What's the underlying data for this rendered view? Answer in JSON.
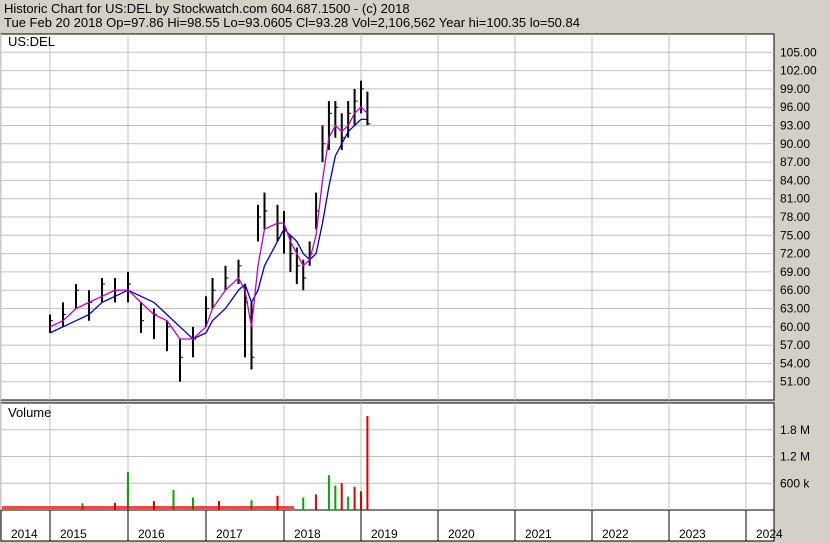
{
  "header": {
    "line1": "Historic Chart for US:DEL by Stockwatch.com 604.687.1500 - (c) 2018",
    "line2": "Tue Feb 20 2018   Op=97.86   Hi=98.55   Lo=93.0605   Cl=93.28   Vol=2,106,562   Year hi=100.35   lo=50.84"
  },
  "colors": {
    "background": "#d4d0c8",
    "plot": "#ffffff",
    "grid": "#c0c0c0",
    "price": "#000000",
    "ma_short": "#c000c0",
    "ma_long": "#0000c0",
    "vol_up": "#00aa00",
    "vol_down": "#dd0000"
  },
  "chart_data": [
    {
      "type": "candlestick",
      "title": "US:DEL",
      "ylim": [
        48,
        108
      ],
      "yticks": [
        "105.00",
        "102.00",
        "99.00",
        "96.00",
        "93.00",
        "90.00",
        "87.00",
        "84.00",
        "81.00",
        "78.00",
        "75.00",
        "72.00",
        "69.00",
        "66.00",
        "63.00",
        "60.00",
        "57.00",
        "54.00",
        "51.00"
      ],
      "x": [
        "2014-01",
        "2014-03",
        "2014-05",
        "2014-07",
        "2014-09",
        "2014-11",
        "2015-01",
        "2015-03",
        "2015-05",
        "2015-07",
        "2015-09",
        "2015-11",
        "2016-01",
        "2016-02",
        "2016-04",
        "2016-06",
        "2016-07",
        "2016-08",
        "2016-09",
        "2016-10",
        "2016-12",
        "2017-01",
        "2017-02",
        "2017-03",
        "2017-04",
        "2017-05",
        "2017-06",
        "2017-07",
        "2017-08",
        "2017-09",
        "2017-10",
        "2017-11",
        "2017-12",
        "2018-01",
        "2018-02"
      ],
      "close": [
        61,
        62,
        66,
        64,
        67,
        66,
        67,
        61,
        62,
        60,
        55,
        58,
        63,
        66,
        68,
        70,
        64,
        55,
        78,
        79,
        77,
        76,
        72,
        70,
        68,
        72,
        79,
        90,
        95,
        96,
        91,
        95,
        97,
        99,
        93.28
      ],
      "high": [
        62,
        64,
        67,
        66,
        68,
        68,
        69,
        64,
        63,
        61,
        58,
        60,
        65,
        68,
        70,
        71,
        67,
        64,
        80,
        82,
        80,
        79,
        75,
        73,
        71,
        74,
        82,
        93,
        97,
        97,
        95,
        97,
        99,
        100.35,
        98.55
      ],
      "low": [
        59,
        60,
        63,
        61,
        64,
        64,
        64,
        59,
        58,
        56,
        51,
        55,
        60,
        63,
        66,
        67,
        55,
        53,
        74,
        76,
        74,
        72,
        69,
        67,
        66,
        70,
        76,
        87,
        89,
        91,
        89,
        91,
        93,
        95,
        93.06
      ],
      "ma_short": [
        60,
        61,
        63,
        64,
        65,
        66,
        66,
        64,
        62,
        61,
        58,
        58,
        60,
        63,
        66,
        68,
        66,
        60,
        70,
        76,
        77,
        77,
        74,
        72,
        70,
        71,
        75,
        84,
        91,
        93,
        92,
        93,
        95,
        96,
        95
      ],
      "ma_long": [
        59,
        60,
        61,
        62,
        64,
        65,
        66,
        65,
        64,
        62,
        60,
        58,
        59,
        61,
        63,
        66,
        67,
        64,
        66,
        70,
        74,
        76,
        75,
        74,
        72,
        71,
        72,
        77,
        83,
        88,
        90,
        92,
        93,
        94,
        94
      ]
    },
    {
      "type": "bar",
      "title": "Volume",
      "ylim": [
        0,
        2400000
      ],
      "yticks": [
        "1.8 M",
        "1.2 M",
        "600 k"
      ],
      "x": [
        "2014-06",
        "2014-11",
        "2015-01",
        "2015-05",
        "2015-08",
        "2015-11",
        "2016-03",
        "2016-08",
        "2016-12",
        "2017-04",
        "2017-06",
        "2017-08",
        "2017-09",
        "2017-10",
        "2017-11",
        "2017-12",
        "2018-01",
        "2018-02"
      ],
      "values": [
        150000,
        160000,
        850000,
        200000,
        450000,
        280000,
        200000,
        220000,
        320000,
        280000,
        350000,
        780000,
        550000,
        600000,
        300000,
        520000,
        420000,
        2106562
      ],
      "direction": [
        "up",
        "down",
        "up",
        "down",
        "up",
        "up",
        "down",
        "up",
        "down",
        "up",
        "down",
        "up",
        "up",
        "down",
        "up",
        "down",
        "down",
        "down"
      ]
    }
  ],
  "x_axis": {
    "labels": [
      "2014",
      "2015",
      "2016",
      "2017",
      "2018",
      "2019",
      "2020",
      "2021",
      "2022",
      "2023",
      "2024"
    ]
  }
}
